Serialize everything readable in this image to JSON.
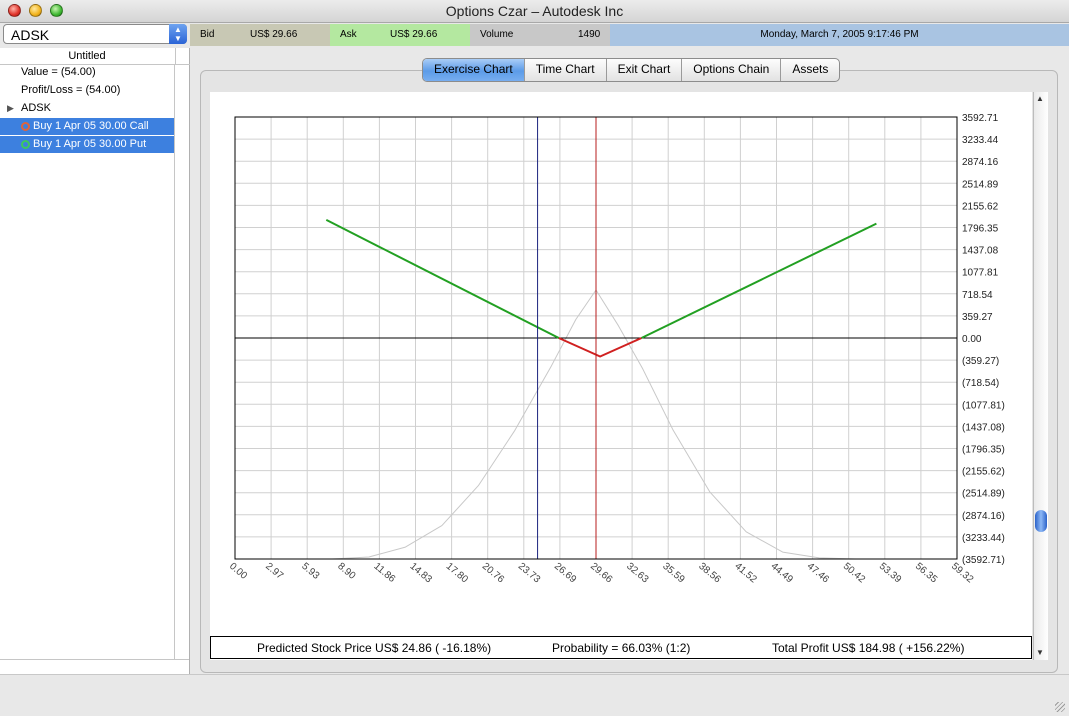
{
  "window": {
    "title": "Options Czar –  Autodesk Inc"
  },
  "symbol_select": {
    "value": "ADSK"
  },
  "quote": {
    "bid_label": "Bid",
    "bid_value": "US$ 29.66",
    "ask_label": "Ask",
    "ask_value": "US$ 29.66",
    "volume_label": "Volume",
    "volume_value": "1490",
    "datetime": "Monday, March 7, 2005 9:17:46 PM",
    "colors": {
      "bid_bg": "#c8c8b4",
      "ask_bg": "#b4e8a0",
      "volume_bg": "#c8c8c8",
      "date_bg": "#a9c4e2"
    }
  },
  "sidebar": {
    "header": "Untitled",
    "items": [
      {
        "label": "Value = (54.00)",
        "selected": false
      },
      {
        "label": "Profit/Loss = (54.00)",
        "selected": false
      },
      {
        "label": "ADSK",
        "selected": false,
        "expand_icon": "disclosure-triangle-icon"
      },
      {
        "label": "Buy 1 Apr 05 30.00 Call",
        "selected": true,
        "ring_color": "#e0643c"
      },
      {
        "label": "Buy 1 Apr 05 30.00 Put",
        "selected": true,
        "ring_color": "#3cc860"
      }
    ]
  },
  "tabs": [
    {
      "label": "Exercise Chart",
      "active": true
    },
    {
      "label": "Time Chart",
      "active": false
    },
    {
      "label": "Exit Chart",
      "active": false
    },
    {
      "label": "Options Chain",
      "active": false
    },
    {
      "label": "Assets",
      "active": false
    }
  ],
  "status": {
    "predicted": "Predicted Stock Price US$ 24.86 ( -16.18%)",
    "probability": "Probability = 66.03% (1:2)",
    "total_profit": "Total Profit US$ 184.98 ( +156.22%)"
  },
  "chart_data": {
    "type": "line",
    "x_ticks": [
      "0.00",
      "2.97",
      "5.93",
      "8.90",
      "11.86",
      "14.83",
      "17.80",
      "20.76",
      "23.73",
      "26.69",
      "29.66",
      "32.63",
      "35.59",
      "38.56",
      "41.52",
      "44.49",
      "47.46",
      "50.42",
      "53.39",
      "56.35",
      "59.32"
    ],
    "y_ticks": [
      "3592.71",
      "3233.44",
      "2874.16",
      "2514.89",
      "2155.62",
      "1796.35",
      "1437.08",
      "1077.81",
      "718.54",
      "359.27",
      "0.00",
      "(359.27)",
      "(718.54)",
      "(1077.81)",
      "(1437.08)",
      "(1796.35)",
      "(2155.62)",
      "(2514.89)",
      "(2874.16)",
      "(3233.44)",
      "(3592.71)"
    ],
    "xlim": [
      0,
      59.32
    ],
    "ylim": [
      -3592.71,
      3592.71
    ],
    "vertical_markers": [
      {
        "x": 24.86,
        "color": "#1a237e"
      },
      {
        "x": 29.66,
        "color": "#b71c1c"
      }
    ],
    "series": [
      {
        "color": "#22a022",
        "x": [
          7.5,
          26.6
        ],
        "y": [
          1920,
          0
        ]
      },
      {
        "color": "#d02020",
        "x": [
          26.6,
          30.0,
          33.4
        ],
        "y": [
          0,
          -300,
          0
        ]
      },
      {
        "color": "#22a022",
        "x": [
          33.4,
          52.7
        ],
        "y": [
          0,
          1860
        ]
      },
      {
        "color": "#c8c8c8",
        "x": [
          8.0,
          11.0,
          14.0,
          17.0,
          20.0,
          23.0,
          26.0,
          28.0,
          29.66,
          31.5,
          33.5,
          36.0,
          39.0,
          42.0,
          45.0,
          48.0,
          51.0
        ],
        "y": [
          -3592,
          -3560,
          -3400,
          -3050,
          -2400,
          -1500,
          -450,
          300,
          780,
          200,
          -500,
          -1500,
          -2500,
          -3150,
          -3480,
          -3575,
          -3592
        ]
      }
    ]
  }
}
